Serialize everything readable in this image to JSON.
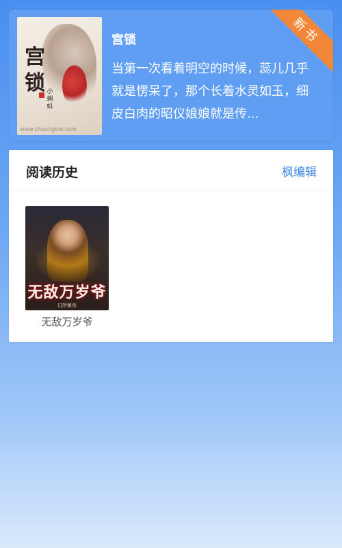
{
  "banner": {
    "book": {
      "title": "宫锁",
      "cover_title": "宫锁",
      "cover_author": "小蝌蚪",
      "watermark": "www.chuangbie.com",
      "description": "当第一次看着明空的时候，蕊儿几乎就是愣呆了，那个长着水灵如玉，细皮白肉的昭仪娘娘就是传..."
    },
    "ribbon_label": "新书",
    "colors": {
      "ribbon": "#f2873a",
      "banner_bg": "#5f9ef2"
    }
  },
  "history": {
    "title": "阅读历史",
    "edit_label": "枫编辑",
    "books": [
      {
        "name": "无敌万岁爷",
        "cover_title": "无敌万岁爷",
        "cover_author": "巳所著杀"
      }
    ]
  }
}
